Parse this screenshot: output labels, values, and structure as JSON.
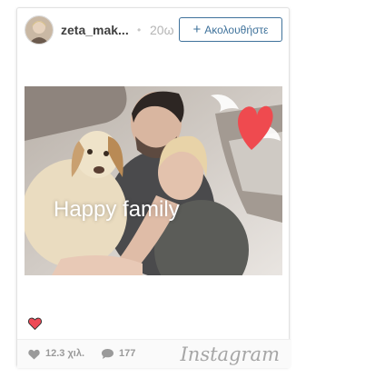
{
  "post": {
    "username": "zeta_mak...",
    "separator": "•",
    "time_ago": "20ω",
    "follow_label": "Ακολουθήστε",
    "follow_plus": "+",
    "photo_caption": "Happy family"
  },
  "footer": {
    "likes": "12.3 χιλ.",
    "comments": "177",
    "brand": "Instagram"
  },
  "icons": {
    "like": "heart-icon",
    "comment": "speech-bubble-icon"
  },
  "colors": {
    "follow_blue": "#3f729b",
    "heart_red": "#ed4956",
    "muted_gray": "#9a9a9a"
  }
}
